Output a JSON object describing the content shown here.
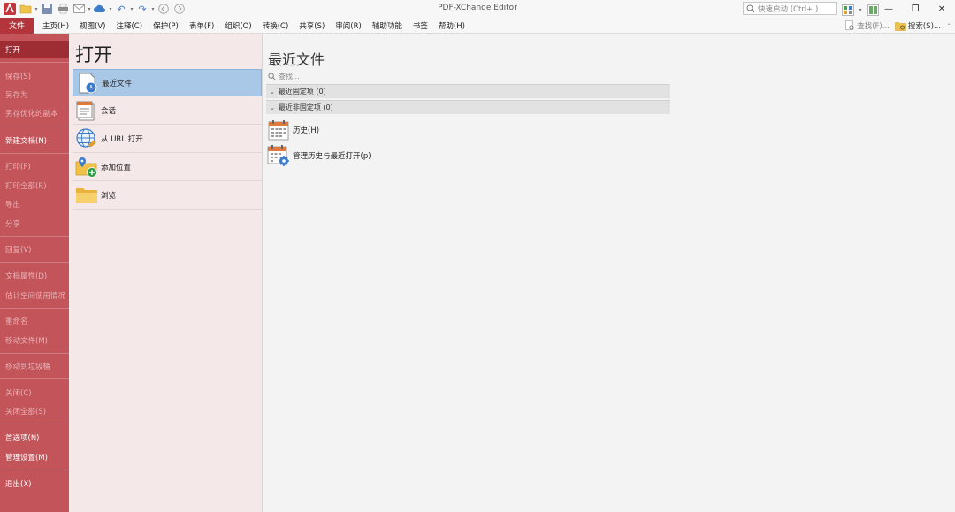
{
  "app": {
    "title": "PDF-XChange Editor",
    "quick_launch_placeholder": "快速启动 (Ctrl+.)",
    "window_controls": {
      "minimize": "—",
      "restore": "❐",
      "close": "✕"
    }
  },
  "quick_access_toolbar": [
    "app-logo-icon",
    "open-folder-icon",
    "save-icon",
    "print-icon",
    "email-icon",
    "cloud-icon",
    "undo-icon",
    "redo-icon",
    "back-icon",
    "forward-icon"
  ],
  "menubar": {
    "file": "文件",
    "items": [
      "主页(H)",
      "视图(V)",
      "注释(C)",
      "保护(P)",
      "表单(F)",
      "组织(O)",
      "转换(C)",
      "共享(S)",
      "审阅(R)",
      "辅助功能",
      "书签",
      "帮助(H)"
    ],
    "find": "查找(F)...",
    "search": "搜索(S)..."
  },
  "leftnav": {
    "items": [
      {
        "label": "打开",
        "state": "active"
      },
      {
        "label": "保存(S)",
        "state": "disabled"
      },
      {
        "label": "另存为",
        "state": "disabled"
      },
      {
        "label": "另存优化的副本",
        "state": "disabled"
      },
      {
        "label": "新建文档(N)",
        "state": "enabled"
      },
      {
        "label": "打印(P)",
        "state": "disabled"
      },
      {
        "label": "打印全部(R)",
        "state": "disabled"
      },
      {
        "label": "导出",
        "state": "disabled"
      },
      {
        "label": "分享",
        "state": "disabled"
      },
      {
        "label": "回复(V)",
        "state": "disabled"
      },
      {
        "label": "文档属性(D)",
        "state": "disabled"
      },
      {
        "label": "估计空间使用情况",
        "state": "disabled"
      },
      {
        "label": "重命名",
        "state": "disabled"
      },
      {
        "label": "移动文件(M)",
        "state": "disabled"
      },
      {
        "label": "移动到垃圾桶",
        "state": "disabled"
      },
      {
        "label": "关闭(C)",
        "state": "disabled"
      },
      {
        "label": "关闭全部(S)",
        "state": "disabled"
      },
      {
        "label": "首选项(N)",
        "state": "enabled"
      },
      {
        "label": "管理设置(M)",
        "state": "enabled"
      },
      {
        "label": "退出(X)",
        "state": "enabled"
      }
    ]
  },
  "open_panel": {
    "heading": "打开",
    "items": [
      {
        "label": "最近文件",
        "icon": "recent-files-icon",
        "active": true
      },
      {
        "label": "会话",
        "icon": "session-icon",
        "active": false
      },
      {
        "label": "从 URL 打开",
        "icon": "globe-link-icon",
        "active": false
      },
      {
        "label": "添加位置",
        "icon": "add-location-icon",
        "active": false
      },
      {
        "label": "浏览",
        "icon": "folder-icon",
        "active": false
      }
    ]
  },
  "content": {
    "heading": "最近文件",
    "search_placeholder": "查找...",
    "groups": [
      {
        "label": "最近固定项 (0)"
      },
      {
        "label": "最近非固定项 (0)"
      }
    ],
    "actions": [
      {
        "label": "历史(H)",
        "icon": "calendar-icon"
      },
      {
        "label": "管理历史与最近打开(p)",
        "icon": "calendar-gear-icon"
      }
    ]
  },
  "colors": {
    "accent_red": "#c2545a",
    "active_red": "#9e2c33",
    "file_tab": "#b3353b",
    "selection_blue": "#a9c7e6"
  }
}
